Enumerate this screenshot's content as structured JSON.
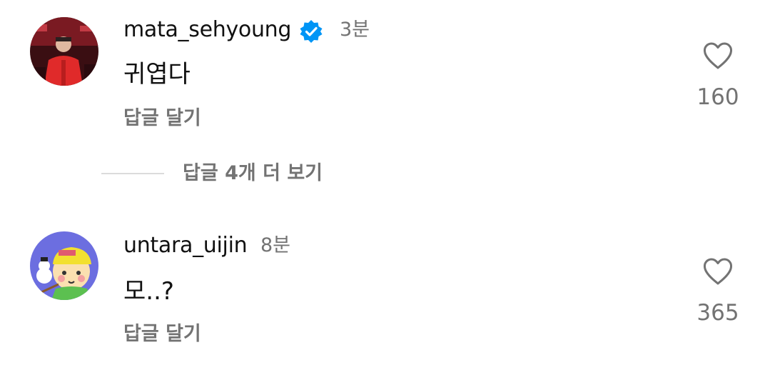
{
  "comments": [
    {
      "username": "mata_sehyoung",
      "verified": true,
      "time": "3분",
      "text": "귀엽다",
      "reply_label": "답글 달기",
      "likes": "160",
      "avatar_icon": "profile-photo"
    },
    {
      "username": "untara_uijin",
      "verified": false,
      "time": "8분",
      "text": "모..?",
      "reply_label": "답글 달기",
      "likes": "365",
      "avatar_icon": "cartoon-avatar"
    }
  ],
  "thread": {
    "view_more_replies": "답글 4개 더 보기"
  },
  "colors": {
    "verified_blue": "#0095f6",
    "secondary_text": "#737373",
    "primary_text": "#111111",
    "divider": "#dbdbdb"
  }
}
